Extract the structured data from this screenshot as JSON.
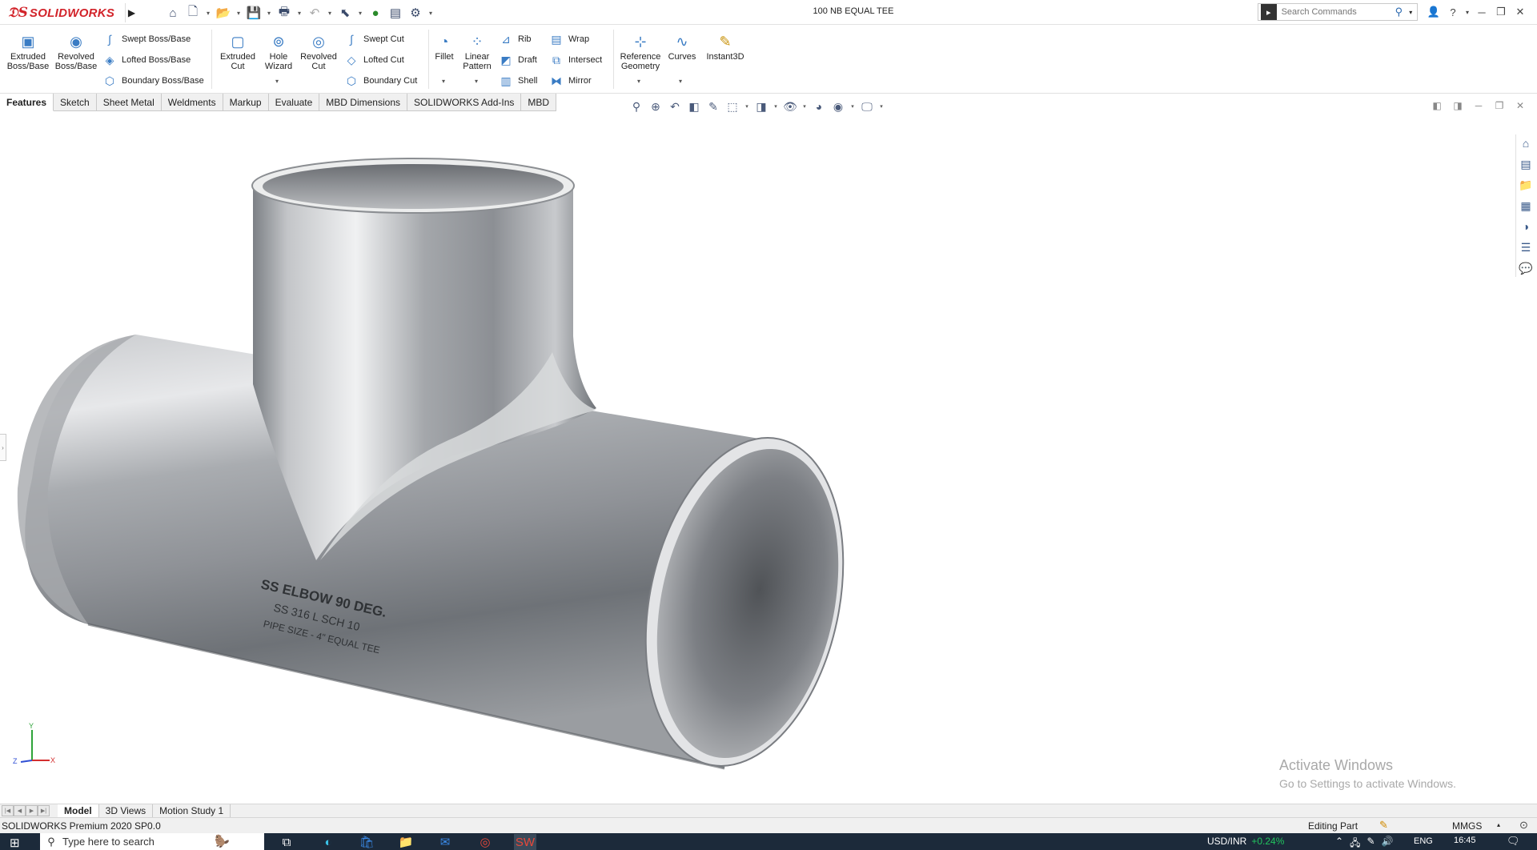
{
  "app": {
    "name": "SOLIDWORKS",
    "document_title": "100 NB EQUAL TEE"
  },
  "quick_access": {
    "items": [
      "home-icon",
      "new-document-icon",
      "open-icon",
      "save-icon",
      "print-icon",
      "undo-icon",
      "select-icon",
      "rebuild-icon",
      "file-properties-icon",
      "options-icon"
    ]
  },
  "search": {
    "placeholder": "Search Commands"
  },
  "ribbon": {
    "extruded_boss": "Extruded\nBoss/Base",
    "revolved_boss": "Revolved\nBoss/Base",
    "swept_boss": "Swept Boss/Base",
    "lofted_boss": "Lofted Boss/Base",
    "boundary_boss": "Boundary Boss/Base",
    "extruded_cut": "Extruded\nCut",
    "hole_wizard": "Hole\nWizard",
    "revolved_cut": "Revolved\nCut",
    "swept_cut": "Swept Cut",
    "lofted_cut": "Lofted Cut",
    "boundary_cut": "Boundary Cut",
    "fillet": "Fillet",
    "linear_pattern": "Linear\nPattern",
    "rib": "Rib",
    "draft": "Draft",
    "shell": "Shell",
    "wrap": "Wrap",
    "intersect": "Intersect",
    "mirror": "Mirror",
    "reference_geometry": "Reference\nGeometry",
    "curves": "Curves",
    "instant3d": "Instant3D"
  },
  "tabs": [
    {
      "label": "Features",
      "active": true
    },
    {
      "label": "Sketch"
    },
    {
      "label": "Sheet Metal"
    },
    {
      "label": "Weldments"
    },
    {
      "label": "Markup"
    },
    {
      "label": "Evaluate"
    },
    {
      "label": "MBD Dimensions"
    },
    {
      "label": "SOLIDWORKS Add-Ins"
    },
    {
      "label": "MBD"
    }
  ],
  "model": {
    "engraving": [
      "SS ELBOW 90 DEG.",
      "SS 316 L SCH 10",
      "PIPE SIZE - 4\" EQUAL TEE"
    ],
    "triad": {
      "x": "X",
      "y": "Y",
      "z": "Z"
    }
  },
  "watermark": {
    "line1": "Activate Windows",
    "line2": "Go to Settings to activate Windows."
  },
  "bottom_tabs": [
    {
      "label": "Model",
      "active": true
    },
    {
      "label": "3D Views"
    },
    {
      "label": "Motion Study 1"
    }
  ],
  "status": {
    "version": "SOLIDWORKS Premium 2020 SP0.0",
    "mode": "Editing Part",
    "units": "MMGS"
  },
  "taskbar": {
    "search_placeholder": "Type here to search",
    "currency": "USD/INR",
    "currency_change": "+0.24%",
    "language": "ENG",
    "time": "16:45"
  }
}
